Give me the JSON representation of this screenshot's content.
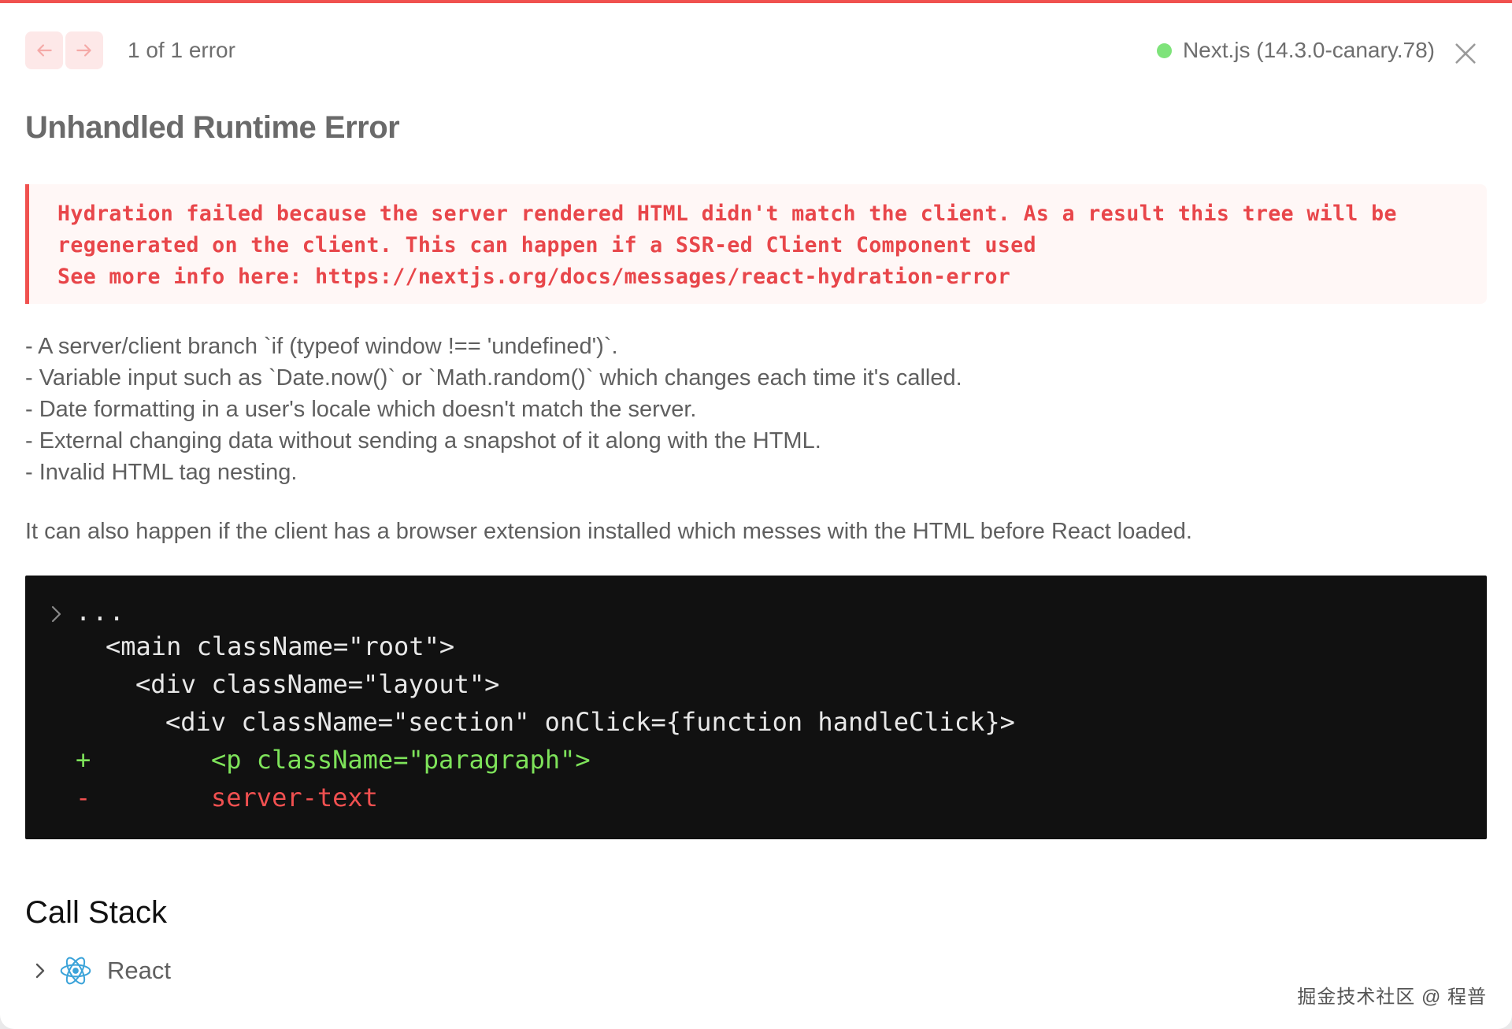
{
  "header": {
    "error_count": "1 of 1 error",
    "version": "Next.js (14.3.0-canary.78)",
    "status_color": "#7ee37a"
  },
  "title": "Unhandled Runtime Error",
  "error_message": [
    "Hydration failed because the server rendered HTML didn't match the client. As a result this tree will be",
    "regenerated on the client. This can happen if a SSR-ed Client Component used",
    "See more info here: https://nextjs.org/docs/messages/react-hydration-error"
  ],
  "causes": [
    "- A server/client branch `if (typeof window !== 'undefined')`.",
    "- Variable input such as `Date.now()` or `Math.random()` which changes each time it's called.",
    "- Date formatting in a user's locale which doesn't match the server.",
    "- External changing data without sending a snapshot of it along with the HTML.",
    "- Invalid HTML tag nesting."
  ],
  "note": "It can also happen if the client has a browser extension installed which messes with the HTML before React loaded.",
  "code": {
    "ellipsis": "...",
    "line1": "<main className=\"root\">",
    "line2": "<div className=\"layout\">",
    "line3": "<div className=\"section\" onClick={function handleClick}>",
    "added_marker": "+",
    "added_line": "<p className=\"paragraph\">",
    "removed_marker": "-",
    "removed_line": "server-text"
  },
  "call_stack": {
    "title": "Call Stack",
    "frame_label": "React"
  },
  "watermark": "掘金技术社区 @ 程普",
  "colors": {
    "accent_red": "#f0514f",
    "error_text": "#e8464a",
    "added_green": "#7ee35a",
    "removed_red": "#f05050",
    "react_blue": "#3ba3d9"
  }
}
